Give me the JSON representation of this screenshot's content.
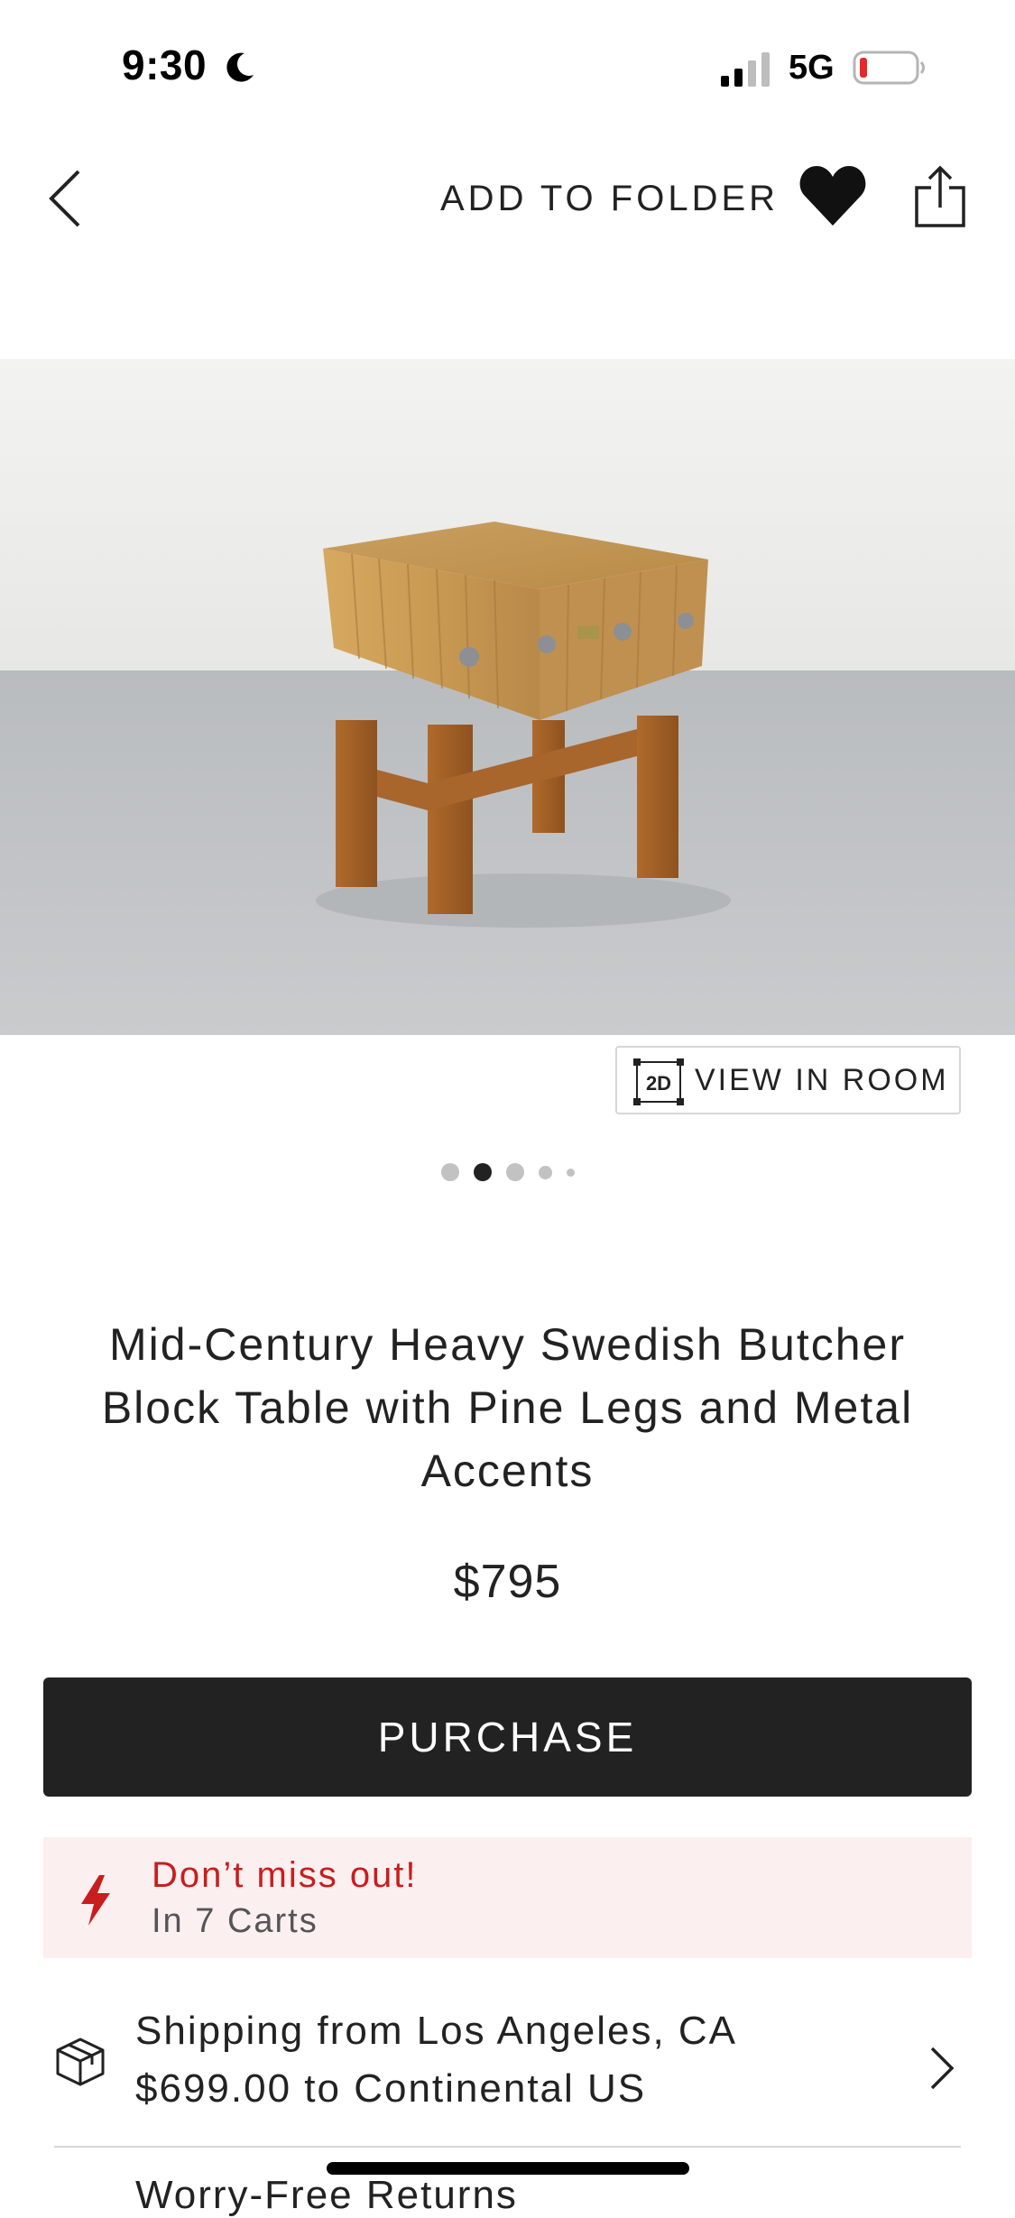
{
  "status_bar": {
    "time": "9:30",
    "network": "5G",
    "icons": [
      "moon-icon",
      "signal-icon",
      "battery-low-icon"
    ]
  },
  "nav": {
    "add_to_folder": "ADD TO FOLDER",
    "icons": [
      "back-chevron-icon",
      "heart-icon",
      "share-icon"
    ]
  },
  "gallery": {
    "view_in_room_badge": "2D",
    "view_in_room_label": "VIEW IN ROOM",
    "current_index": 1
  },
  "product": {
    "title": "Mid-Century Heavy Swedish Butcher Block Table with Pine Legs and Metal Accents",
    "price": "$795"
  },
  "actions": {
    "purchase_label": "PURCHASE"
  },
  "urgency": {
    "title": "Don’t miss out!",
    "subtitle": "In 7 Carts",
    "icon": "lightning-icon"
  },
  "shipping": {
    "title": "Shipping from Los Angeles, CA",
    "subtitle": "$699.00 to Continental US",
    "icon": "box-icon"
  },
  "next_row_partial": "Worry-Free Returns",
  "colors": {
    "primary_dark": "#222222",
    "urgency_red": "#c81e1e",
    "urgency_bg": "#fcefef"
  }
}
